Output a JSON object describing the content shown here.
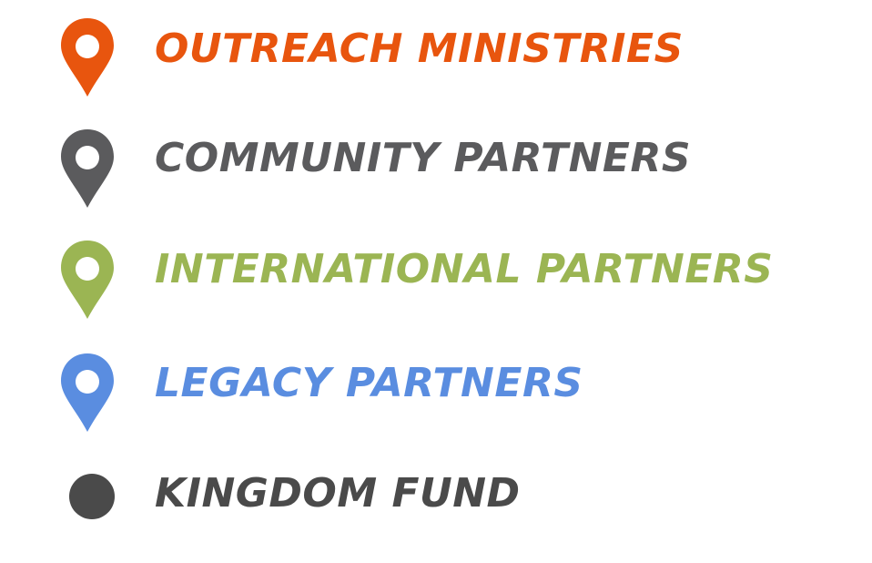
{
  "legend": {
    "items": [
      {
        "label": "OUTREACH MINISTRIES",
        "color": "#e8550e",
        "icon": "map-pin-icon"
      },
      {
        "label": "COMMUNITY PARTNERS",
        "color": "#5b5b5d",
        "icon": "map-pin-icon"
      },
      {
        "label": "INTERNATIONAL PARTNERS",
        "color": "#9bb553",
        "icon": "map-pin-icon"
      },
      {
        "label": "LEGACY PARTNERS",
        "color": "#5a8de0",
        "icon": "map-pin-icon"
      },
      {
        "label": "KINGDOM FUND",
        "color": "#4a4a4a",
        "icon": "dot-icon"
      }
    ]
  }
}
